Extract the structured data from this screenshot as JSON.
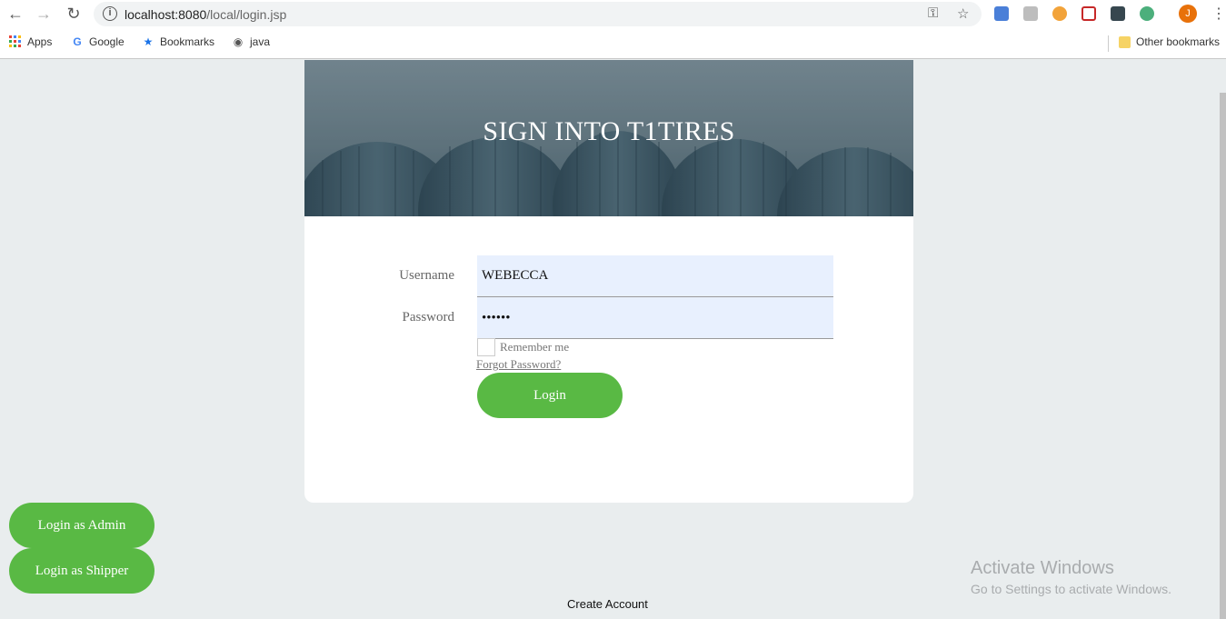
{
  "browser": {
    "url_host": "localhost:8080",
    "url_path": "/local/login.jsp",
    "avatar_initial": "J",
    "bookmarks": [
      {
        "label": "Apps",
        "icon": "apps-grid-icon"
      },
      {
        "label": "Google",
        "icon": "google-icon"
      },
      {
        "label": "Bookmarks",
        "icon": "star-icon"
      },
      {
        "label": "java",
        "icon": "globe-icon"
      }
    ],
    "other_bookmarks": "Other bookmarks"
  },
  "banner": {
    "title": "SIGN INTO T1TIRES"
  },
  "form": {
    "username_label": "Username",
    "username_value": "WEBECCA",
    "password_label": "Password",
    "password_value": "••••••",
    "remember_label": "Remember me",
    "forgot_link": "Forgot Password?",
    "login_button": "Login"
  },
  "side_buttons": {
    "admin": "Login as Admin",
    "shipper": "Login as Shipper"
  },
  "footer": {
    "create_account": "Create Account"
  },
  "watermark": {
    "title": "Activate Windows",
    "subtitle": "Go to Settings to activate Windows."
  },
  "colors": {
    "accent_green": "#59b944",
    "page_bg": "#e9edee",
    "autofill_bg": "#e8f0fe"
  }
}
